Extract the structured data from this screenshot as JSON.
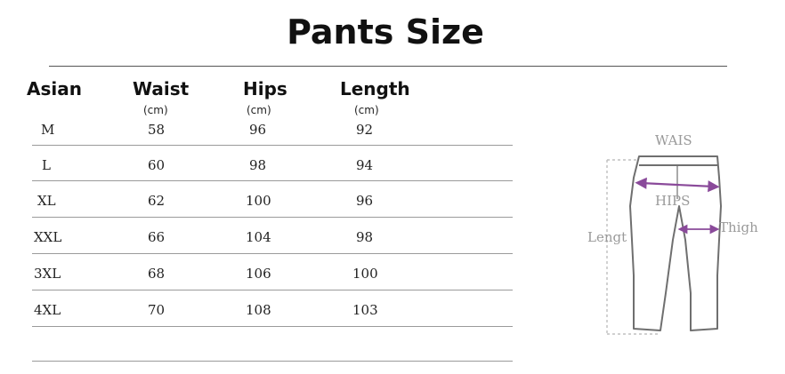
{
  "title": "Pants Size",
  "columns": [
    {
      "label": "Asian",
      "unit": ""
    },
    {
      "label": "Waist",
      "unit": "(cm)"
    },
    {
      "label": "Hips",
      "unit": "(cm)"
    },
    {
      "label": "Length",
      "unit": "(cm)"
    }
  ],
  "rows": [
    {
      "size": "M",
      "waist": "58",
      "hips": "96",
      "length": "92"
    },
    {
      "size": "L",
      "waist": "60",
      "hips": "98",
      "length": "94"
    },
    {
      "size": "XL",
      "waist": "62",
      "hips": "100",
      "length": "96"
    },
    {
      "size": "XXL",
      "waist": "66",
      "hips": "104",
      "length": "98"
    },
    {
      "size": "3XL",
      "waist": "68",
      "hips": "106",
      "length": "100"
    },
    {
      "size": "4XL",
      "waist": "70",
      "hips": "108",
      "length": "103"
    }
  ],
  "diagram": {
    "waist_label": "WAIS",
    "hips_label": "HIPS",
    "thigh_label": "Thigh",
    "length_label": "Lengt",
    "outline_color": "#6f6f6f",
    "arrow_color": "#8a4a9a",
    "dash_color": "#b5b5b5"
  }
}
